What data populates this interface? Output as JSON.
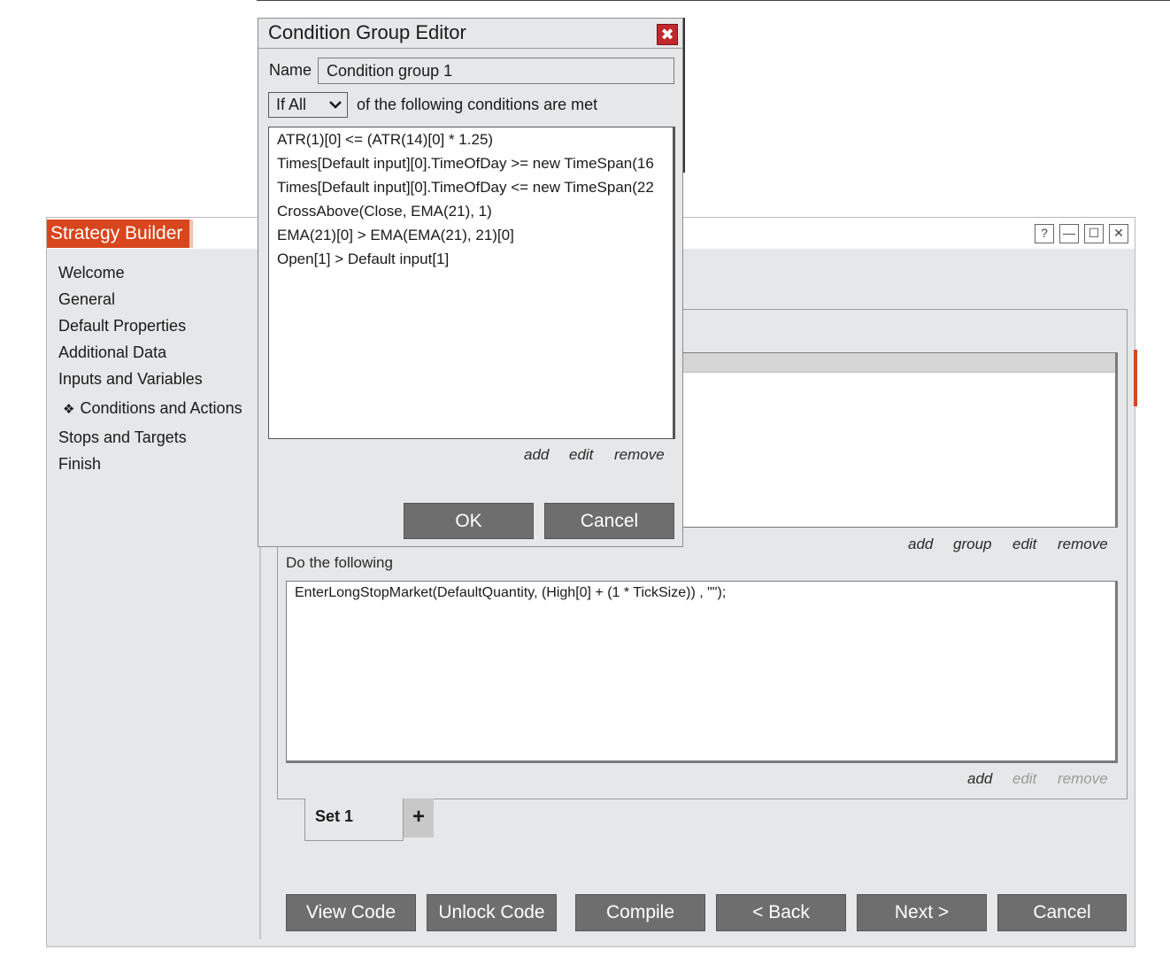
{
  "window": {
    "title": "Strategy Builder",
    "controls": {
      "help": "?",
      "minimize": "—",
      "maximize": "☐",
      "close": "✕"
    }
  },
  "sidebar": {
    "items": [
      {
        "label": "Welcome"
      },
      {
        "label": "General"
      },
      {
        "label": "Default Properties"
      },
      {
        "label": "Additional Data"
      },
      {
        "label": "Inputs and Variables"
      },
      {
        "label": "Conditions and Actions",
        "active": true,
        "bullet": "❖"
      },
      {
        "label": "Stops and Targets"
      },
      {
        "label": "Finish"
      }
    ]
  },
  "conditions_panel": {
    "links": {
      "add": "add",
      "group": "group",
      "edit": "edit",
      "remove": "remove"
    }
  },
  "actions_panel": {
    "label": "Do the following",
    "items": [
      "EnterLongStopMarket(DefaultQuantity, (High[0] + (1 * TickSize)) , \"\");"
    ],
    "links": {
      "add": "add",
      "edit": "edit",
      "remove": "remove"
    }
  },
  "tabs": {
    "set1": "Set 1",
    "add": "+"
  },
  "bottom_buttons": {
    "view_code": "View Code",
    "unlock_code": "Unlock Code",
    "compile": "Compile",
    "back": "< Back",
    "next": "Next >",
    "cancel": "Cancel"
  },
  "dialog": {
    "title": "Condition Group Editor",
    "close": "✖",
    "name_label": "Name",
    "name_value": "Condition group 1",
    "match_mode": "If All",
    "match_suffix": "of the following conditions are met",
    "conditions": [
      "ATR(1)[0] <= (ATR(14)[0] * 1.25)",
      "Times[Default input][0].TimeOfDay >= new TimeSpan(16",
      "Times[Default input][0].TimeOfDay <= new TimeSpan(22",
      "CrossAbove(Close, EMA(21), 1)",
      "EMA(21)[0] > EMA(EMA(21), 21)[0]",
      "Open[1] > Default input[1]"
    ],
    "links": {
      "add": "add",
      "edit": "edit",
      "remove": "remove"
    },
    "ok": "OK",
    "cancel": "Cancel"
  }
}
